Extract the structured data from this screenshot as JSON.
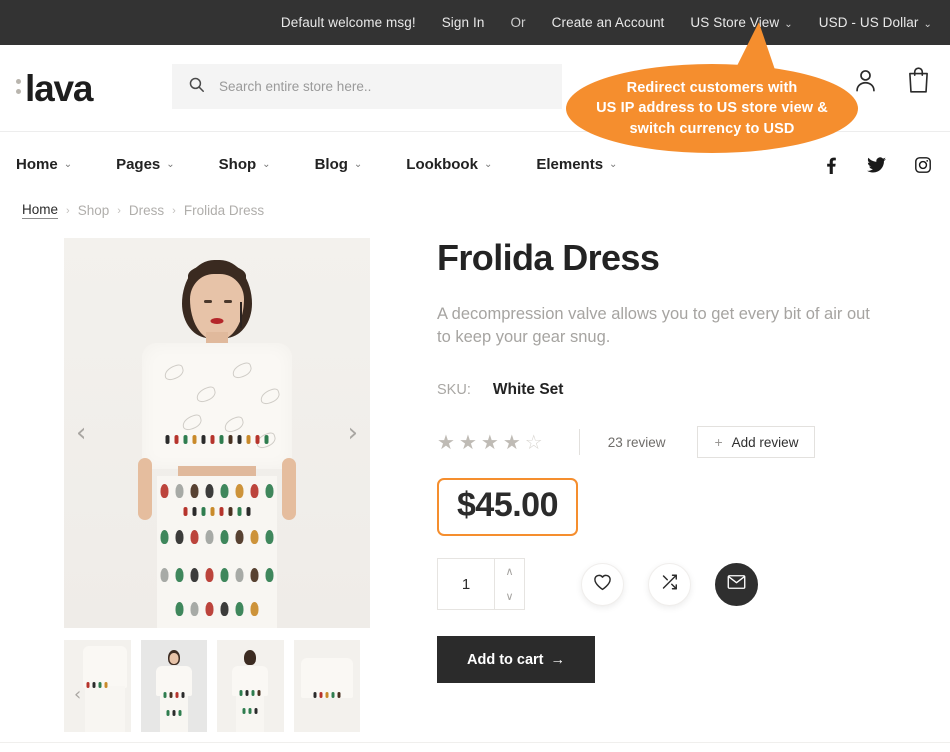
{
  "topbar": {
    "welcome": "Default welcome msg!",
    "sign_in": "Sign In",
    "or": "Or",
    "create_account": "Create an Account",
    "store_view": "US Store View",
    "currency": "USD - US Dollar",
    "caret": "⌄"
  },
  "header": {
    "logo": "lava",
    "search_placeholder": "Search entire store here..",
    "search_value": "",
    "icons": {
      "account": "account-icon",
      "cart": "cart-icon",
      "search": "search-icon"
    }
  },
  "nav": {
    "items": [
      {
        "label": "Home",
        "caret": "⌄"
      },
      {
        "label": "Pages",
        "caret": "⌄"
      },
      {
        "label": "Shop",
        "caret": "⌄"
      },
      {
        "label": "Blog",
        "caret": "⌄"
      },
      {
        "label": "Lookbook",
        "caret": "⌄"
      },
      {
        "label": "Elements",
        "caret": "⌄"
      }
    ],
    "social": [
      "facebook-icon",
      "twitter-icon",
      "instagram-icon"
    ]
  },
  "breadcrumb": {
    "items": [
      "Home",
      "Shop",
      "Dress",
      "Frolida Dress"
    ],
    "separator": "›"
  },
  "gallery": {
    "prev": "‹",
    "next": "›",
    "thumb_prev": "‹",
    "thumbnail_count": 4,
    "selected_thumbnail": 2
  },
  "product": {
    "title": "Frolida Dress",
    "description": "A decompression valve allows you to get every bit of air out to keep your gear  snug.",
    "sku_label": "SKU:",
    "sku_value": "White Set",
    "rating": 4,
    "rating_max": 5,
    "review_count_label": "23 review",
    "add_review_label": "Add review",
    "add_review_plus": "+",
    "price": "$45.00",
    "price_border_color": "#f58e2e",
    "quantity": "1",
    "qty_up": "∧",
    "qty_down": "∨",
    "wishlist_icon": "heart-icon",
    "compare_icon": "shuffle-icon",
    "email_icon": "envelope-icon",
    "add_to_cart_label": "Add to cart",
    "add_to_cart_arrow": "→"
  },
  "callout": {
    "text": "Redirect customers with US IP address to US store view & switch currency to USD",
    "line1": "Redirect customers with",
    "line2": "US IP address to US store view &",
    "line3": "switch currency to USD",
    "color": "#f58e2e"
  },
  "colors": {
    "topbar_bg": "#333333",
    "accent": "#f58e2e",
    "text_dark": "#232323",
    "text_muted": "#a6a4a1",
    "button_dark": "#2b2b2b"
  }
}
